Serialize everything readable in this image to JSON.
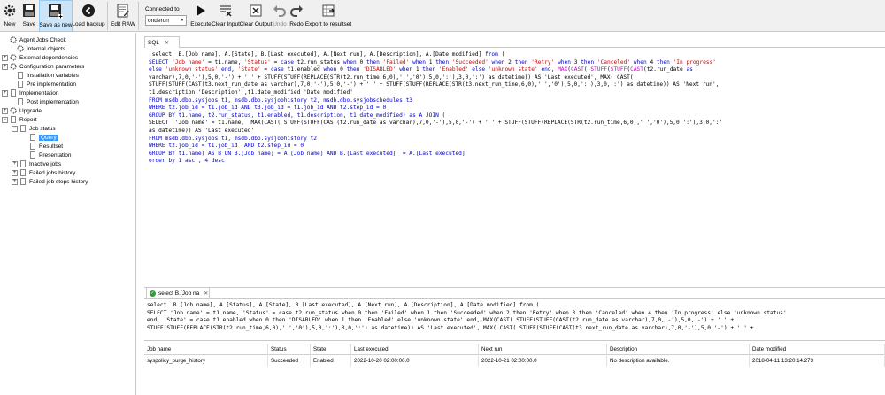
{
  "toolbar": {
    "new": "New",
    "save": "Save",
    "save_as_new": "Save as new",
    "load_backup": "Load backup",
    "edit_raw": "Edit RAW",
    "connected_to": "Connected to",
    "connection": "onderon",
    "execute": "Execute",
    "clear_input": "Clear Input",
    "clear_output": "Clear Output",
    "undo": "Undo",
    "redo": "Redo",
    "export": "Export to resultset"
  },
  "tree": {
    "root": "Agent Jobs Check",
    "internal": "Internal objects",
    "external": "External dependencies",
    "config": "Configuration parameters",
    "install": "Installation variables",
    "pre": "Pre implementation",
    "impl": "Implementation",
    "post": "Post implementation",
    "upgrade": "Upgrade",
    "report": "Report",
    "job_status": "Job status",
    "query": "Query",
    "resultset": "Resultset",
    "presentation": "Presentation",
    "inactive": "Inactive jobs",
    "failed_history": "Failed jobs history",
    "failed_steps": "Failed job steps history"
  },
  "editor_tab": "SQL",
  "sql": {
    "l1a": " select  B.[Job name], A.[State], B.[Last executed], A.[Next run], A.[Description], A.[Date modified] ",
    "l1b": "from",
    "l1c": " (",
    "l2a": "SELECT",
    "l2b": " 'Job name'",
    "l2c": " = t1.name, ",
    "l2d": "'Status'",
    "l2e": " = ",
    "l2f": "case",
    "l2g": " t2.run_status ",
    "l2h": "when",
    "l2i": " 0 ",
    "l2j": "then",
    "l2k": " 'Failed'",
    "l2l": " when",
    "l2m": " 1 ",
    "l2n": "then",
    "l2o": " 'Succeeded'",
    "l2p": " when",
    "l2q": " 2 ",
    "l2r": "then",
    "l2s": " 'Retry'",
    "l2t": " when",
    "l2u": " 3 ",
    "l2v": "then",
    "l2w": " 'Canceled'",
    "l2x": " when",
    "l2y": " 4 ",
    "l2z": "then",
    "l2za": " 'In progress'",
    "l3a": "else",
    "l3b": " 'unknown status'",
    "l3c": " end",
    "l3d": ", ",
    "l3e": "'State'",
    "l3f": " = ",
    "l3g": "case",
    "l3h": " t1.enabled ",
    "l3i": "when",
    "l3j": " 0 ",
    "l3k": "then",
    "l3l": " 'DISABLED'",
    "l3m": " when",
    "l3n": " 1 ",
    "l3o": "then",
    "l3p": " 'Enabled'",
    "l3q": " else",
    "l3r": " 'unknown state'",
    "l3s": " end",
    "l3t": ", ",
    "l3u": "MAX",
    "l3v": "(",
    "l3w": "CAST",
    "l3x": "( ",
    "l3y": "STUFF",
    "l3z": "(",
    "l3za": "STUFF",
    "l3zb": "(",
    "l3zc": "CAST",
    "l3zd": "(t2.run_date ",
    "l3ze": "as",
    "line3_rest": "varchar),7,0,'-'),5,0,'-') + ' ' + STUFF(STUFF(REPLACE(STR(t2.run_time,6,0),' ','0'),5,0,':'),3,0,':') as datetime)) AS 'Last executed', MAX( CAST(",
    "line4": "STUFF(STUFF(CAST(t3.next_run_date as varchar),7,0,'-'),5,0,'-') + ' ' + STUFF(STUFF(REPLACE(STR(t3.next_run_time,6,0),' ','0'),5,0,':'),3,0,':') as datetime)) AS 'Next run',",
    "line5": "t1.description 'Description' ,t1.date_modified 'Date modified'",
    "line6": "FROM msdb.dbo.sysjobs t1, msdb.dbo.sysjobhistory t2, msdb.dbo.sysjobschedules t3",
    "line7": "WHERE t2.job_id = t1.job_id AND t3.job_id = t1.job_id AND t2.step_id = 0",
    "line8": "GROUP BY t1.name, t2.run_status, t1.enabled, t1.description, t1.date_modified) as A JOIN (",
    "line9": "SELECT  'Job name' = t1.name,  MAX(CAST( STUFF(STUFF(CAST(t2.run_date as varchar),7,0,'-'),5,0,'-') + ' ' + STUFF(STUFF(REPLACE(STR(t2.run_time,6,0),' ','0'),5,0,':'),3,0,':'",
    "line10": "as datetime)) AS 'Last executed'",
    "line11": "FROM msdb.dbo.sysjobs t1, msdb.dbo.sysjobhistory t2",
    "line12": "WHERE t2.job_id = t1.job_id  AND t2.step_id = 0",
    "line13": "GROUP BY t1.name) AS B ON B.[Job name] = A.[Job name] AND B.[Last executed]  = A.[Last executed]",
    "line14": "order by 1 asc , 4 desc"
  },
  "result_tab": "select B.[Job na",
  "result_query": {
    "l1": "select  B.[Job name], A.[Status], A.[State], B.[Last executed], A.[Next run], A.[Description], A.[Date modified] from (",
    "l2": "SELECT 'Job name' = t1.name, 'Status' = case t2.run_status when 0 then 'Failed' when 1 then 'Succeeded' when 2 then 'Retry' when 3 then 'Canceled' when 4 then 'In progress' else 'unknown status'",
    "l3": "end, 'State' = case t1.enabled when 0 then 'DISABLED' when 1 then 'Enabled' else 'unknown state' end, MAX(CAST( STUFF(STUFF(CAST(t2.run_date as varchar),7,0,'-'),5,0,'-') + ' ' +",
    "l4": "STUFF(STUFF(REPLACE(STR(t2.run_time,6,0),' ','0'),5,0,':'),3,0,':') as datetime)) AS 'Last executed', MAX( CAST( STUFF(STUFF(CAST(t3.next_run_date as varchar),7,0,'-'),5,0,'-') + ' ' +"
  },
  "grid": {
    "headers": [
      "Job name",
      "Status",
      "State",
      "Last executed",
      "Next run",
      "Description",
      "Date modified"
    ],
    "row": [
      "syspolicy_purge_history",
      "Succeeded",
      "Enabled",
      "2022-10-20 02:00:00.0",
      "2022-10-21 02:00:00.0",
      "No description available.",
      "2018-04-11 13:20:14.273"
    ]
  },
  "colors": {
    "keyword": "#0000cc",
    "string": "#cc0000",
    "function": "#cc00cc",
    "selection": "#3399ff"
  }
}
